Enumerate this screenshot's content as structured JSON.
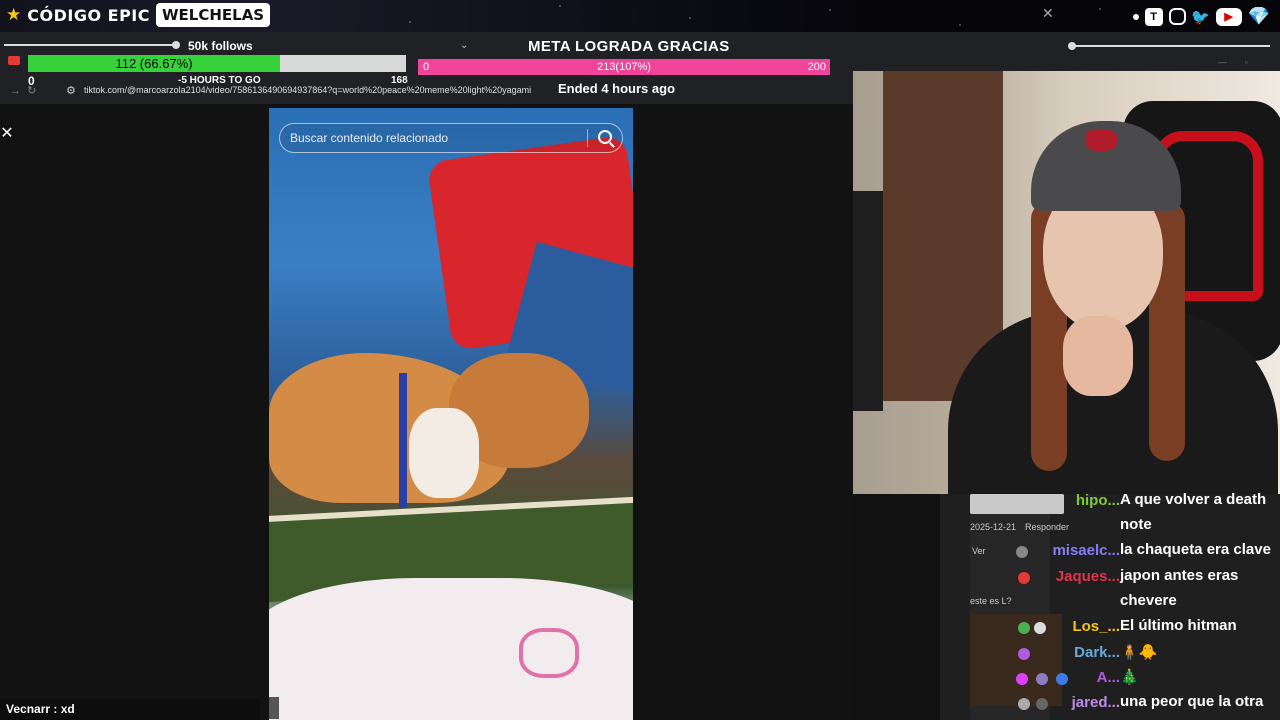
{
  "banner": {
    "brand_code": "CÓDIGO EPIC",
    "brand_name": "WELCHELAS",
    "icons": [
      "star-icon",
      "twitch-icon",
      "instagram-icon",
      "twitter-icon",
      "youtube-icon",
      "gem-icon"
    ]
  },
  "goals": {
    "follows_label": "50k follows",
    "meta_title": "META LOGRADA GRACIAS",
    "green_bar": {
      "label": "112 (66.67%)",
      "progress": 0.6667,
      "min": "0",
      "max": "168",
      "time_left": "-5 HOURS TO GO",
      "color": "#37d13b"
    },
    "pink_bar": {
      "label": "213(107%)",
      "min": "0",
      "max": "200",
      "progress": 1.0,
      "color": "#f0449b"
    },
    "ended": "Ended 4 hours ago"
  },
  "browser": {
    "url": "tiktok.com/@marcoarzola2104/video/7586136490694937864?q=world%20peace%20meme%20light%20yagami"
  },
  "video": {
    "search_placeholder": "Buscar contenido relacionado"
  },
  "chat_left": {
    "text": "Vecnarr : xd"
  },
  "chat": {
    "meta_1": {
      "date": "2025-12-21",
      "reply": "Responder"
    },
    "meta_2": "Ver",
    "meta_3": "este es L?",
    "rows": [
      {
        "user": "hipo...",
        "message": "A que volver a death",
        "color": "#7ec93b"
      },
      {
        "user": "",
        "message": "note",
        "color": "#ffffff"
      },
      {
        "user": "misaelc...",
        "message": "la chaqueta era clave",
        "color": "#8a7cf6"
      },
      {
        "user": "Jaques...",
        "message": "japon antes eras",
        "color": "#e0344a"
      },
      {
        "user": "",
        "message": "chevere",
        "color": "#ffffff"
      },
      {
        "user": "Los_...",
        "message": "El último hitman",
        "color": "#f5c518"
      },
      {
        "user": "Dark...",
        "message": "",
        "color": "#6aa9d8"
      },
      {
        "user": "A...",
        "message": "",
        "color": "#b05be0"
      },
      {
        "user": "jared...",
        "message": "una peor que la otra",
        "color": "#c08be8"
      }
    ]
  }
}
